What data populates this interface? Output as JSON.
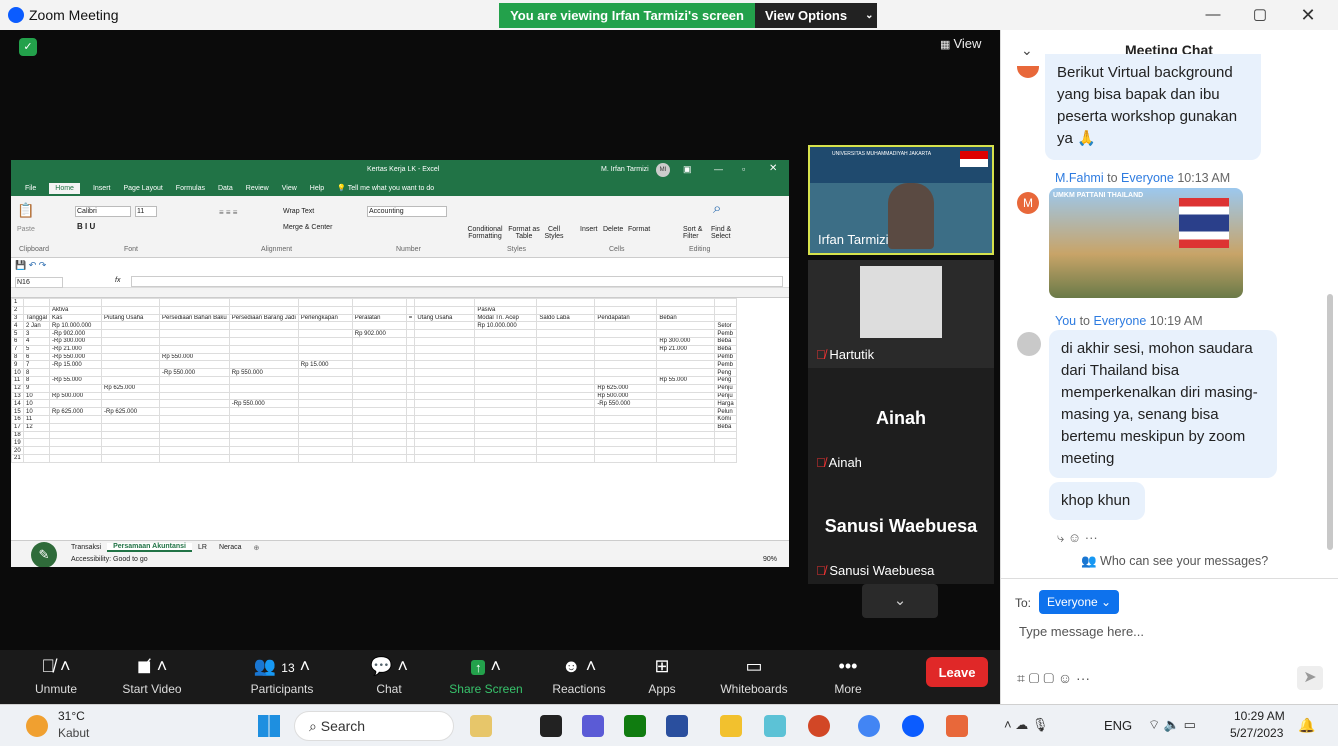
{
  "window": {
    "title": "Zoom Meeting",
    "banner": "You are viewing Irfan Tarmizi's screen",
    "view_options": "View Options",
    "view_btn": "View"
  },
  "excel": {
    "title": "Kertas Kerja LK - Excel",
    "user": "M. Irfan Tarmizi",
    "user_initials": "MI",
    "menu": [
      "File",
      "Home",
      "Insert",
      "Page Layout",
      "Formulas",
      "Data",
      "Review",
      "View",
      "Help"
    ],
    "tell_me": "Tell me what you want to do",
    "ribbon": {
      "font": "Calibri",
      "size": "11",
      "wrap": "Wrap Text",
      "merge": "Merge & Center",
      "number_format": "Accounting",
      "cond": "Conditional Formatting",
      "format_table": "Format as Table",
      "cell_styles": "Cell Styles",
      "insert": "Insert",
      "delete": "Delete",
      "format": "Format",
      "sort": "Sort & Filter",
      "find": "Find & Select",
      "groups": [
        "Clipboard",
        "Font",
        "Alignment",
        "Number",
        "Styles",
        "Cells",
        "Editing"
      ],
      "paste": "Paste"
    },
    "name_box": "N16",
    "fx": "fx",
    "columns": [
      "A",
      "B",
      "C",
      "D",
      "E",
      "F",
      "G",
      "H",
      "I",
      "J",
      "K",
      "L",
      "M",
      "N"
    ],
    "section_aktiva": "Aktiva",
    "section_pasiva": "Pasiva",
    "headers": [
      "Tanggal",
      "Kas",
      "Piutang Usaha",
      "Persediaan Bahan Baku",
      "Persediaan Barang Jadi",
      "Perlengkapan",
      "Peralatan",
      "=",
      "Utang Usaha",
      "Modal Tn. Acep",
      "Saldo Laba",
      "Pendapatan",
      "Beban"
    ],
    "rows": [
      {
        "n": "4",
        "a": "2",
        "b": "Jan",
        "kas": "Rp 10.000.000",
        "k": "Rp 10.000.000",
        "o": "Setor"
      },
      {
        "n": "5",
        "a": "3",
        "kas": "-Rp 902.000",
        "h": "Rp 902.000",
        "o": "Pemb"
      },
      {
        "n": "6",
        "a": "4",
        "kas": "-Rp 300.000",
        "nn": "Rp 300.000",
        "o": "Beba"
      },
      {
        "n": "7",
        "a": "5",
        "kas": "-Rp 21.000",
        "nn": "Rp 21.000",
        "o": "Beba"
      },
      {
        "n": "8",
        "a": "6",
        "kas": "-Rp 550.000",
        "e": "Rp 550.000",
        "o": "Pemb"
      },
      {
        "n": "9",
        "a": "7",
        "kas": "-Rp 15.000",
        "g": "Rp 15.000",
        "o": "Pemb"
      },
      {
        "n": "10",
        "a": "8",
        "e": "-Rp 550.000",
        "f": "Rp 550.000",
        "o": "Peng"
      },
      {
        "n": "11",
        "a": "8",
        "kas": "-Rp 55.000",
        "nn": "Rp 55.000",
        "o": "Peng"
      },
      {
        "n": "12",
        "a": "9",
        "d": "Rp 625.000",
        "m": "Rp 625.000",
        "o": "Penju"
      },
      {
        "n": "13",
        "a": "10",
        "kas": "Rp 500.000",
        "m": "Rp 500.000",
        "o": "Penju"
      },
      {
        "n": "14",
        "a": "10",
        "f": "-Rp 550.000",
        "m": "-Rp 550.000",
        "o": "Harga"
      },
      {
        "n": "15",
        "a": "10",
        "kas": "Rp 625.000",
        "d": "-Rp 625.000",
        "o": "Pelun"
      },
      {
        "n": "16",
        "a": "11",
        "o": "Komi"
      },
      {
        "n": "17",
        "a": "12",
        "o": "Beba"
      },
      {
        "n": "18"
      },
      {
        "n": "19"
      },
      {
        "n": "20"
      },
      {
        "n": "21"
      }
    ],
    "sheets": [
      "Transaksi",
      "Persamaan Akuntansi",
      "LR",
      "Neraca"
    ],
    "status": "Accessibility: Good to go",
    "zoom": "90%"
  },
  "participants": [
    {
      "name": "Irfan Tarmizi",
      "bg_text": "UNIVERSITAS MUHAMMADIYAH JAKARTA"
    },
    {
      "name": "Hartutik"
    },
    {
      "name": "Ainah",
      "big": "Ainah"
    },
    {
      "name": "Sanusi Waebuesa",
      "big": "Sanusi Waebuesa"
    }
  ],
  "toolbar": [
    {
      "label": "Unmute",
      "icon": "mic-off-icon"
    },
    {
      "label": "Start Video",
      "icon": "video-off-icon"
    },
    {
      "label": "Participants",
      "icon": "participants-icon",
      "count": "13"
    },
    {
      "label": "Chat",
      "icon": "chat-icon"
    },
    {
      "label": "Share Screen",
      "icon": "share-icon"
    },
    {
      "label": "Reactions",
      "icon": "reactions-icon"
    },
    {
      "label": "Apps",
      "icon": "apps-icon"
    },
    {
      "label": "Whiteboards",
      "icon": "whiteboard-icon"
    },
    {
      "label": "More",
      "icon": "more-icon"
    }
  ],
  "leave": "Leave",
  "chat": {
    "title": "Meeting Chat",
    "msg1": "Berikut Virtual background yang bisa bapak dan ibu peserta workshop gunakan ya 🙏",
    "msg2_sender": "M.Fahmi",
    "msg2_to": "to",
    "msg2_target": "Everyone",
    "msg2_time": "10:13 AM",
    "msg2_avatar": "M",
    "msg2_image_label": "UMKM PATTANI THAILAND",
    "msg3_sender": "You",
    "msg3_to": "to",
    "msg3_target": "Everyone",
    "msg3_time": "10:19 AM",
    "msg3_text": "di akhir sesi, mohon saudara dari Thailand bisa memperkenalkan diri masing-masing ya, senang bisa bertemu meskipun by zoom meeting",
    "msg4_text": "khop khun",
    "who_can_see": "Who can see your messages?",
    "to_label": "To:",
    "to_value": "Everyone",
    "placeholder": "Type message here..."
  },
  "taskbar": {
    "weather_temp": "31°C",
    "weather_desc": "Kabut",
    "search": "Search",
    "lang": "ENG",
    "time": "10:29 AM",
    "date": "5/27/2023"
  }
}
